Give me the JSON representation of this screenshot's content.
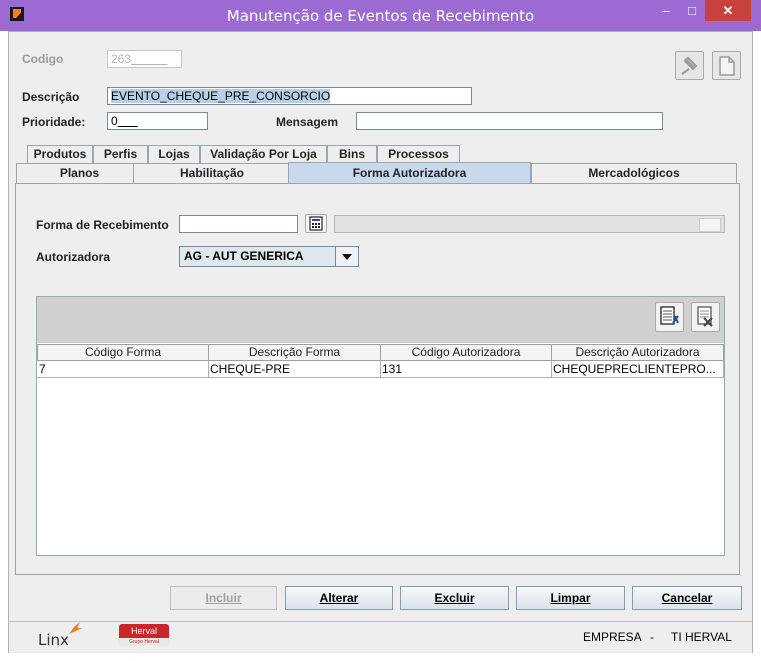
{
  "window": {
    "title": "Manutenção de Eventos de Recebimento",
    "minimize": "–",
    "maximize": "□",
    "close": "✕"
  },
  "form": {
    "codigo_label": "Codigo",
    "codigo_value": "263",
    "descricao_label": "Descrição",
    "descricao_value": "EVENTO_CHEQUE_PRE_CONSORCIO",
    "prioridade_label": "Prioridade:",
    "prioridade_value": "0",
    "mensagem_label": "Mensagem",
    "mensagem_value": ""
  },
  "tabs_row1": [
    "Produtos",
    "Perfis",
    "Lojas",
    "Validação Por Loja",
    "Bins",
    "Processos"
  ],
  "tabs_row2": [
    "Planos",
    "Habilitação",
    "Forma Autorizadora",
    "Mercadológicos"
  ],
  "active_tab": "Forma Autorizadora",
  "panel": {
    "forma_label": "Forma de Recebimento",
    "forma_value": "",
    "autorizadora_label": "Autorizadora",
    "autorizadora_value": "AG - AUT GENERICA"
  },
  "table": {
    "columns": [
      "Código Forma",
      "Descrição Forma",
      "Código Autorizadora",
      "Descrição Autorizadora"
    ],
    "rows": [
      [
        "7",
        "CHEQUE-PRE",
        "131",
        "CHEQUEPRECLIENTEPRO..."
      ]
    ]
  },
  "buttons": {
    "incluir": "Incluir",
    "alterar": "Alterar",
    "excluir": "Excluir",
    "limpar": "Limpar",
    "cancelar": "Cancelar"
  },
  "status": {
    "linx_logo": "Linx",
    "herval_logo": "Herval",
    "herval_sub": "Grupo Herval",
    "empresa": "EMPRESA",
    "separator": "-",
    "empresa_value": "TI HERVAL"
  },
  "colors": {
    "titlebar": "#9b6bd3",
    "close": "#c7423a",
    "active_tab": "#c8d9ec",
    "herval_red": "#c8262a"
  }
}
